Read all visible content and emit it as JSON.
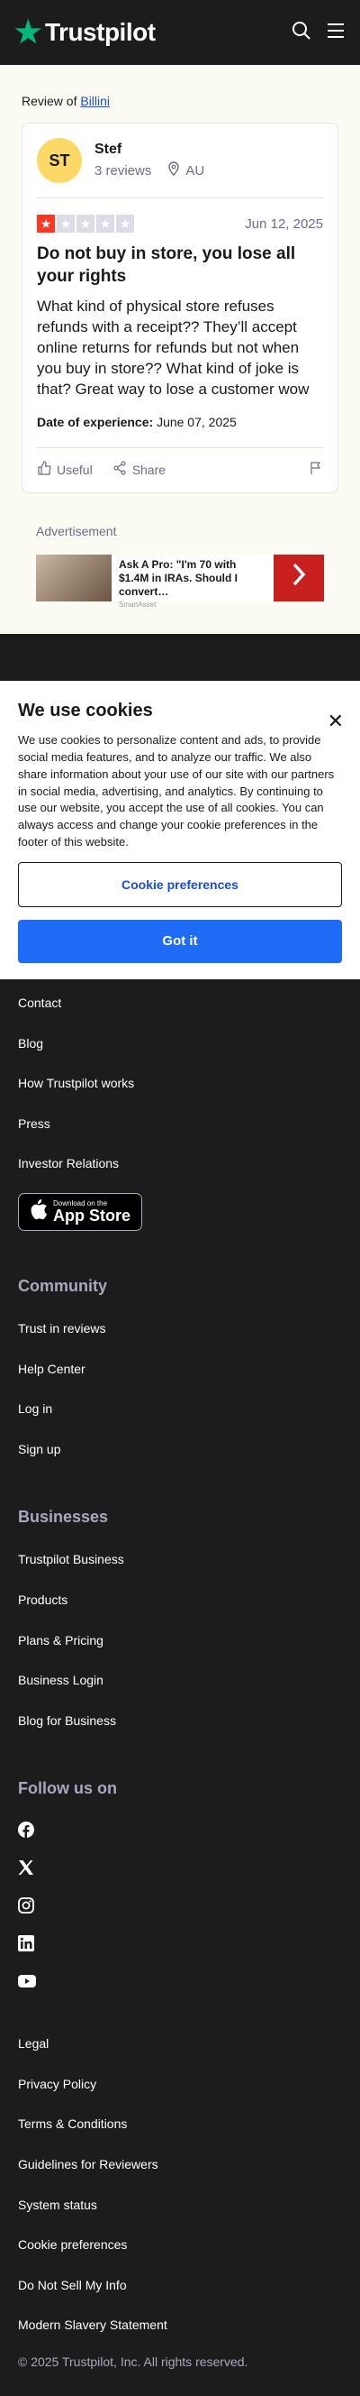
{
  "header": {
    "logo_text": "Trustpilot",
    "icons": [
      "search-icon",
      "menu-icon"
    ],
    "brand_color": "#00b67a"
  },
  "review_page": {
    "review_of_prefix": "Review of",
    "company_name": "Billini"
  },
  "review": {
    "avatar_initials": "ST",
    "reviewer_name": "Stef",
    "review_count": "3 reviews",
    "location": "AU",
    "rating": 1,
    "max_rating": 5,
    "date": "Jun 12, 2025",
    "title": "Do not buy in store, you lose all your rights",
    "body": "What kind of physical store refuses refunds with a receipt?? They’ll accept online returns for refunds but not when you buy in store?? What kind of joke is that? Great way to lose a customer wow",
    "experience_label": "Date of experience:",
    "experience_date": "June 07, 2025",
    "useful_label": "Useful",
    "share_label": "Share"
  },
  "advertisement": {
    "label": "Advertisement",
    "title": "Ask A Pro: \"I'm 70 with $1.4M in IRAs. Should I convert…",
    "source": "SmartAsset"
  },
  "cookies": {
    "title": "We use cookies",
    "text": "We use cookies to personalize content and ads, to provide social media features, and to analyze our traffic. We also share information about your use of our site with our partners in social media, advertising, and analytics. By continuing to use our website, you accept the use of all cookies. You can always access and change your cookie preferences in the footer of this website.",
    "preferences_button": "Cookie preferences",
    "accept_button": "Got it"
  },
  "footer": {
    "about_links": [
      "Contact",
      "Blog",
      "How Trustpilot works",
      "Press",
      "Investor Relations"
    ],
    "app_store_small": "Download on the",
    "app_store_big": "App Store",
    "community_heading": "Community",
    "community_links": [
      "Trust in reviews",
      "Help Center",
      "Log in",
      "Sign up"
    ],
    "businesses_heading": "Businesses",
    "business_links": [
      "Trustpilot Business",
      "Products",
      "Plans & Pricing",
      "Business Login",
      "Blog for Business"
    ],
    "follow_heading": "Follow us on",
    "social_icons": [
      "facebook-icon",
      "x-icon",
      "instagram-icon",
      "linkedin-icon",
      "youtube-icon"
    ],
    "legal_links": [
      "Legal",
      "Privacy Policy",
      "Terms & Conditions",
      "Guidelines for Reviewers",
      "System status",
      "Cookie preferences",
      "Do Not Sell My Info",
      "Modern Slavery Statement"
    ],
    "copyright": "© 2025 Trustpilot, Inc. All rights reserved."
  }
}
